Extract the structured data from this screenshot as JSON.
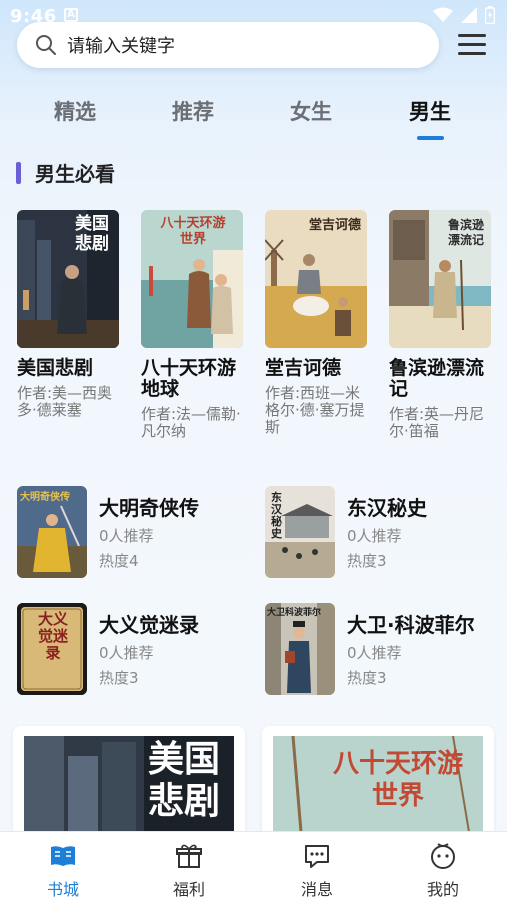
{
  "status": {
    "time": "9:46"
  },
  "search": {
    "placeholder": "请输入关键字"
  },
  "tabs": [
    {
      "label": "精选"
    },
    {
      "label": "推荐"
    },
    {
      "label": "女生"
    },
    {
      "label": "男生",
      "active": true
    }
  ],
  "section": {
    "title": "男生必看"
  },
  "featured": [
    {
      "title": "美国悲剧",
      "author": "作者:美—西奥多·德莱塞",
      "cover_text": "美国悲剧"
    },
    {
      "title": "八十天环游地球",
      "author": "作者:法—儒勒·凡尔纳",
      "cover_text": "八十天环游世界"
    },
    {
      "title": "堂吉诃德",
      "author": "作者:西班—米格尔·德·塞万提斯",
      "cover_text": "堂吉诃德"
    },
    {
      "title": "鲁滨逊漂流记",
      "author": "作者:英—丹尼尔·笛福",
      "cover_text": "鲁滨逊漂流记"
    }
  ],
  "list": [
    {
      "name": "大明奇侠传",
      "rec": "0人推荐",
      "hot": "热度4",
      "cover_text": "大明奇侠传"
    },
    {
      "name": "东汉秘史",
      "rec": "0人推荐",
      "hot": "热度3",
      "cover_text": "东汉秘史"
    },
    {
      "name": "大义觉迷录",
      "rec": "0人推荐",
      "hot": "热度3",
      "cover_text": "大义觉迷录"
    },
    {
      "name": "大卫·科波菲尔",
      "rec": "0人推荐",
      "hot": "热度3",
      "cover_text": "大卫科波菲尔"
    }
  ],
  "banners": [
    {
      "cover_text": "美国悲剧"
    },
    {
      "cover_text": "八十天环游世界"
    }
  ],
  "nav": [
    {
      "label": "书城",
      "icon": "book-icon",
      "active": true
    },
    {
      "label": "福利",
      "icon": "gift-icon"
    },
    {
      "label": "消息",
      "icon": "message-icon"
    },
    {
      "label": "我的",
      "icon": "profile-icon"
    }
  ],
  "colors": {
    "accent": "#1e7fd8",
    "section_bar": "#6b5fd8"
  }
}
